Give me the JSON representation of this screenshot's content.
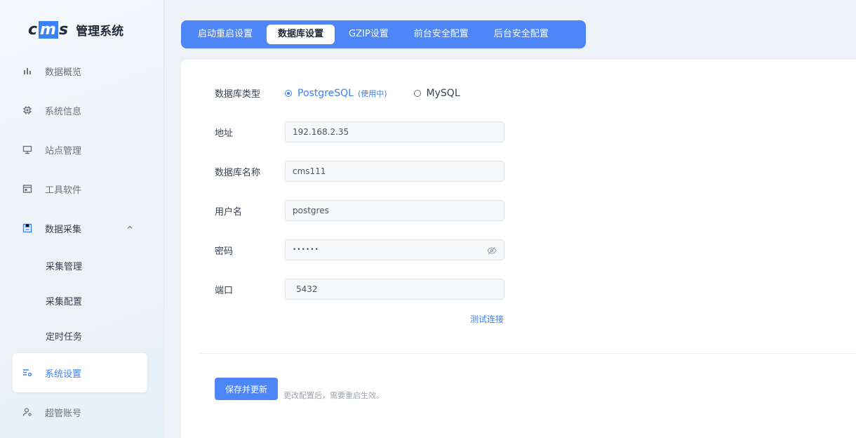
{
  "brand": {
    "logo": "cms",
    "title": "管理系统"
  },
  "sidebar": {
    "items": [
      {
        "label": "数据概览",
        "icon": "bar-chart-icon"
      },
      {
        "label": "系统信息",
        "icon": "chip-icon"
      },
      {
        "label": "站点管理",
        "icon": "monitor-icon"
      },
      {
        "label": "工具软件",
        "icon": "window-icon"
      },
      {
        "label": "数据采集",
        "icon": "save-icon"
      }
    ],
    "subitems": [
      "采集管理",
      "采集配置",
      "定时任务"
    ],
    "active": {
      "label": "系统设置",
      "icon": "settings-list-icon"
    },
    "last": {
      "label": "超管账号",
      "icon": "user-gear-icon"
    }
  },
  "tabs": [
    "启动重启设置",
    "数据库设置",
    "GZIP设置",
    "前台安全配置",
    "后台安全配置"
  ],
  "active_tab": "数据库设置",
  "form": {
    "db_type_label": "数据库类型",
    "db_types": [
      {
        "label": "PostgreSQL",
        "tag": "(使用中)",
        "checked": true
      },
      {
        "label": "MySQL",
        "checked": false
      }
    ],
    "address_label": "地址",
    "address_value": "192.168.2.35",
    "dbname_label": "数据库名称",
    "dbname_value": "cms111",
    "user_label": "用户名",
    "user_value": "postgres",
    "password_label": "密码",
    "password_value": "••••••",
    "port_label": "端口",
    "port_value": "5432",
    "test_link": "测试连接",
    "save_button": "保存并更新",
    "hint": "更改配置后，需要重启生效。"
  },
  "colors": {
    "accent": "#4f86f7",
    "link": "#3b82f6"
  }
}
